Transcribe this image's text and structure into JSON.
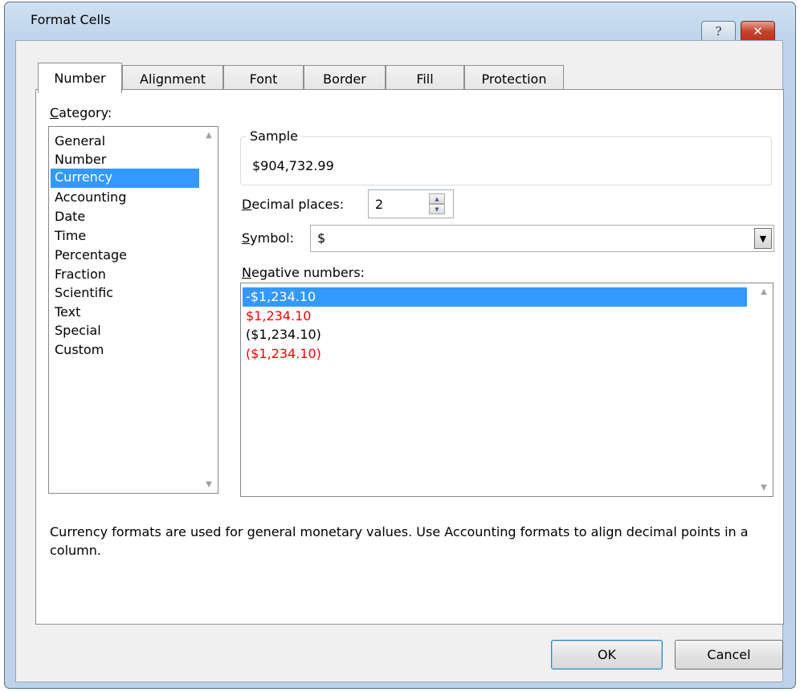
{
  "window": {
    "title": "Format Cells",
    "help_glyph": "?",
    "close_glyph": "✕"
  },
  "tabs": [
    {
      "label": "Number",
      "active": true
    },
    {
      "label": "Alignment",
      "active": false
    },
    {
      "label": "Font",
      "active": false
    },
    {
      "label": "Border",
      "active": false
    },
    {
      "label": "Fill",
      "active": false
    },
    {
      "label": "Protection",
      "active": false
    }
  ],
  "category": {
    "label_accel": "C",
    "label_rest": "ategory:",
    "items": [
      "General",
      "Number",
      "Currency",
      "Accounting",
      "Date",
      "Time",
      "Percentage",
      "Fraction",
      "Scientific",
      "Text",
      "Special",
      "Custom"
    ],
    "selected": "Currency"
  },
  "sample": {
    "legend": "Sample",
    "value": "$904,732.99"
  },
  "decimal_places": {
    "label_accel": "D",
    "label_rest": "ecimal places:",
    "value": "2"
  },
  "symbol": {
    "label_accel": "S",
    "label_rest": "ymbol:",
    "value": "$"
  },
  "negative_numbers": {
    "label_accel": "N",
    "label_rest": "egative numbers:",
    "items": [
      {
        "text": "-$1,234.10",
        "color": "#000000",
        "selected": true
      },
      {
        "text": "$1,234.10",
        "color": "#ff0000",
        "selected": false
      },
      {
        "text": "($1,234.10)",
        "color": "#000000",
        "selected": false
      },
      {
        "text": "($1,234.10)",
        "color": "#ff0000",
        "selected": false
      }
    ]
  },
  "description": "Currency formats are used for general monetary values.  Use Accounting formats to align decimal points in a column.",
  "buttons": {
    "ok": "OK",
    "cancel": "Cancel"
  },
  "colors": {
    "selection": "#3399ff",
    "negative_red": "#ff0000"
  }
}
